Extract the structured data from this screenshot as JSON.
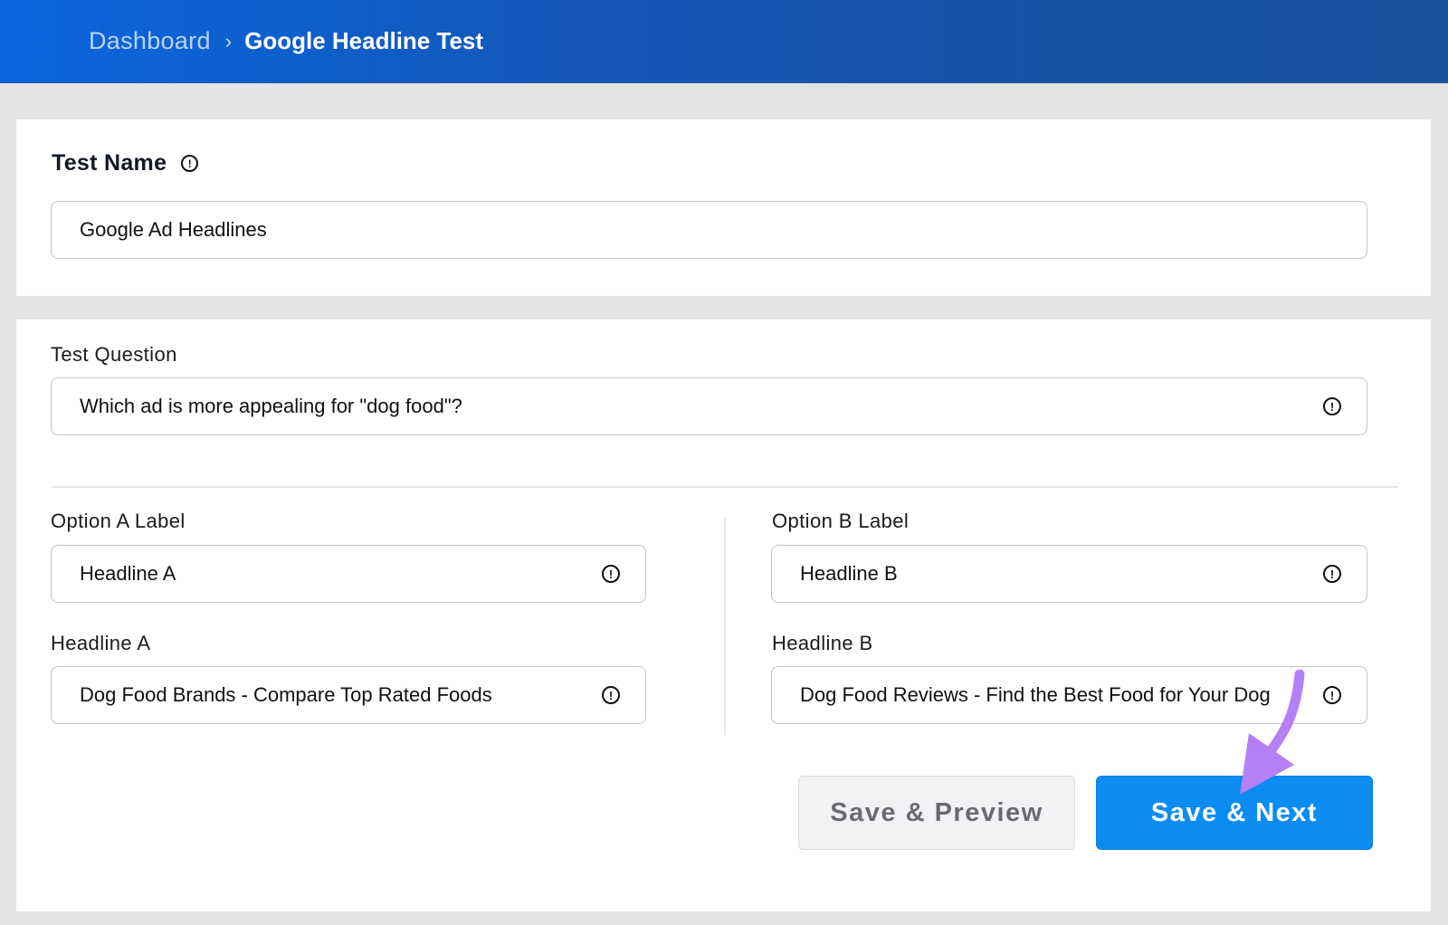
{
  "breadcrumb": {
    "parent": "Dashboard",
    "separator": "›",
    "current": "Google Headline Test"
  },
  "test_name": {
    "title": "Test Name",
    "value": "Google Ad Headlines"
  },
  "test_question": {
    "label": "Test Question",
    "value": "Which ad is more appealing for \"dog food\"?"
  },
  "option_a": {
    "label_title": "Option A Label",
    "label_value": "Headline A",
    "headline_title": "Headline A",
    "headline_value": "Dog Food Brands - Compare Top Rated Foods"
  },
  "option_b": {
    "label_title": "Option B Label",
    "label_value": "Headline B",
    "headline_title": "Headline B",
    "headline_value": "Dog Food Reviews - Find the Best Food for Your Dog"
  },
  "buttons": {
    "preview": "Save & Preview",
    "next": "Save & Next"
  },
  "icons": {
    "info": "!"
  },
  "colors": {
    "header_start": "#0a66e0",
    "header_end": "#19519b",
    "primary_button": "#0a8cf2",
    "annotation_arrow": "#b57ff5"
  }
}
